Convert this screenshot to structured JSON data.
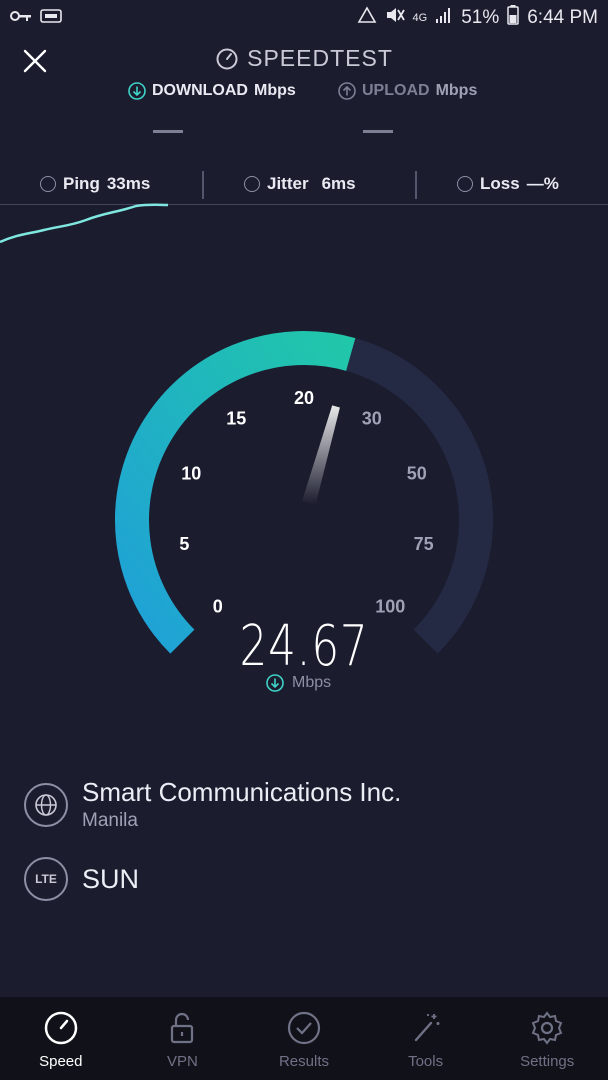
{
  "status_bar": {
    "battery": "51%",
    "time": "6:44 PM",
    "network": "4G"
  },
  "header": {
    "title": "SPEEDTEST",
    "download_label": "DOWNLOAD",
    "download_unit": "Mbps",
    "upload_label": "UPLOAD",
    "upload_unit": "Mbps"
  },
  "stats": {
    "ping_label": "Ping",
    "ping_value": "33ms",
    "jitter_label": "Jitter",
    "jitter_value": "6ms",
    "loss_label": "Loss",
    "loss_value": "—%"
  },
  "gauge": {
    "ticks": [
      "0",
      "5",
      "10",
      "15",
      "20",
      "30",
      "50",
      "75",
      "100"
    ],
    "current_value": "24.67",
    "current_unit": "Mbps",
    "accent_start": "#1fa0d8",
    "accent_end": "#21c7a9"
  },
  "provider": {
    "name": "Smart Communications Inc.",
    "location": "Manila",
    "network_badge": "LTE",
    "carrier": "SUN"
  },
  "nav": {
    "items": [
      {
        "label": "Speed",
        "icon": "speedometer-icon"
      },
      {
        "label": "VPN",
        "icon": "lock-icon"
      },
      {
        "label": "Results",
        "icon": "checkmark-icon"
      },
      {
        "label": "Tools",
        "icon": "magic-wand-icon"
      },
      {
        "label": "Settings",
        "icon": "gear-icon"
      }
    ]
  }
}
